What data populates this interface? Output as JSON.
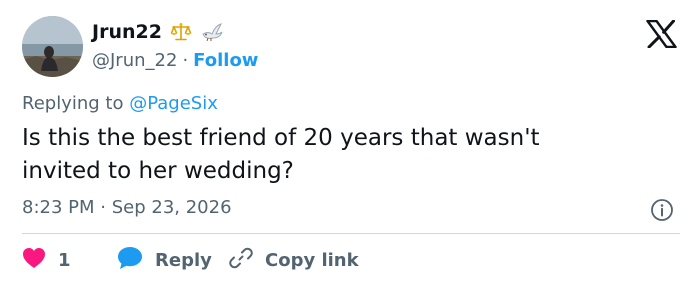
{
  "author": {
    "display_name": "Jrun22",
    "badges": [
      "scales-icon",
      "dove-icon"
    ],
    "handle": "@Jrun_22",
    "separator": "·",
    "follow_label": "Follow"
  },
  "reply_context": {
    "prefix": "Replying to ",
    "mention": "@PageSix"
  },
  "tweet": {
    "text": "Is this the best friend of 20 years that wasn't\ninvited to her wedding?",
    "time": "8:23 PM",
    "separator": "·",
    "date": "Sep 23, 2026"
  },
  "actions": {
    "like_count": "1",
    "reply_label": "Reply",
    "copy_label": "Copy link"
  },
  "colors": {
    "accent": "#1d9bf0",
    "like": "#f91880",
    "secondary_text": "#536471",
    "divider": "#cfd9de"
  }
}
